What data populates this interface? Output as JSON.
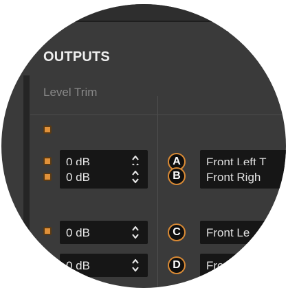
{
  "section_title": "OUTPUTS",
  "column_label": "Level Trim",
  "colors": {
    "panel_bg": "#3a3a3a",
    "field_bg": "#161616",
    "accent_orange": "#e0913a",
    "text_primary": "#efefef",
    "text_muted": "#8a8a8a"
  },
  "master_dot": {
    "icon": "indicator-square-icon"
  },
  "outputs": [
    {
      "trim": "0 dB",
      "letter": "A",
      "name": "Front Left T"
    },
    {
      "trim": "0 dB",
      "letter": "B",
      "name": "Front Righ"
    },
    {
      "trim": "0 dB",
      "letter": "C",
      "name": "Front Le"
    },
    {
      "trim": "0 dB",
      "letter": "D",
      "name": "Fro"
    }
  ],
  "spin_icon": "up-down-arrows-icon"
}
